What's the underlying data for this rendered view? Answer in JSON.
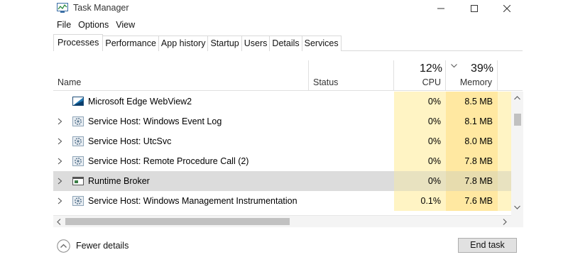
{
  "window": {
    "title": "Task Manager",
    "icon": "task-manager-icon",
    "controls": [
      "minimize-icon",
      "maximize-icon",
      "close-icon"
    ]
  },
  "menu": [
    "File",
    "Options",
    "View"
  ],
  "tabs": [
    {
      "label": "Processes",
      "active": true
    },
    {
      "label": "Performance",
      "active": false
    },
    {
      "label": "App history",
      "active": false
    },
    {
      "label": "Startup",
      "active": false
    },
    {
      "label": "Users",
      "active": false
    },
    {
      "label": "Details",
      "active": false
    },
    {
      "label": "Services",
      "active": false
    }
  ],
  "columns": {
    "name": "Name",
    "status": "Status",
    "cpu": {
      "label": "CPU",
      "total": "12%"
    },
    "memory": {
      "label": "Memory",
      "total": "39%",
      "sorted": "descending"
    }
  },
  "processes": [
    {
      "name": "Microsoft Edge WebView2",
      "status": "",
      "cpu": "0%",
      "memory": "8.5 MB",
      "expandable": false,
      "icon": "webview-icon",
      "selected": false
    },
    {
      "name": "Service Host: Windows Event Log",
      "status": "",
      "cpu": "0%",
      "memory": "8.1 MB",
      "expandable": true,
      "icon": "gear-icon",
      "selected": false
    },
    {
      "name": "Service Host: UtcSvc",
      "status": "",
      "cpu": "0%",
      "memory": "8.0 MB",
      "expandable": true,
      "icon": "gear-icon",
      "selected": false
    },
    {
      "name": "Service Host: Remote Procedure Call (2)",
      "status": "",
      "cpu": "0%",
      "memory": "7.8 MB",
      "expandable": true,
      "icon": "gear-icon",
      "selected": false
    },
    {
      "name": "Runtime Broker",
      "status": "",
      "cpu": "0%",
      "memory": "7.8 MB",
      "expandable": true,
      "icon": "window-icon",
      "selected": true
    },
    {
      "name": "Service Host: Windows Management Instrumentation",
      "status": "",
      "cpu": "0.1%",
      "memory": "7.6 MB",
      "expandable": true,
      "icon": "gear-icon",
      "selected": false
    }
  ],
  "footer": {
    "fewer_details": "Fewer details",
    "end_task": "End task"
  },
  "colors": {
    "cpu_heat": "#fff4c4",
    "memory_heat": "#ffe8a1",
    "selected_row": "#dcdcdc"
  }
}
